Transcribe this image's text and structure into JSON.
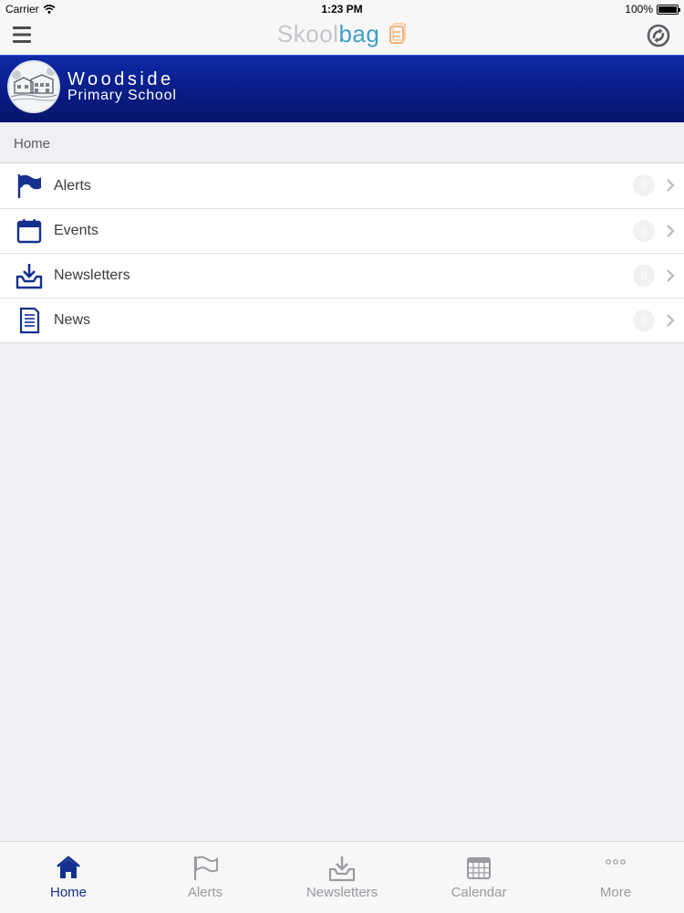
{
  "status_bar": {
    "carrier": "Carrier",
    "time": "1:23 PM",
    "battery": "100%",
    "battery_level_percent": 100
  },
  "nav_bar": {
    "brand_light": "Skool",
    "brand_accent": "bag",
    "menu_icon": "hamburger-menu-icon",
    "sync_icon": "sync-icon"
  },
  "school": {
    "name_line1": "Woodside",
    "name_line2": "Primary School"
  },
  "breadcrumb": "Home",
  "menu_items": [
    {
      "label": "Alerts",
      "icon": "flag-icon",
      "badge": "0"
    },
    {
      "label": "Events",
      "icon": "calendar-icon",
      "badge": "0"
    },
    {
      "label": "Newsletters",
      "icon": "inbox-download-icon",
      "badge": "0"
    },
    {
      "label": "News",
      "icon": "document-icon",
      "badge": "0"
    }
  ],
  "tabs": [
    {
      "label": "Home",
      "icon": "home-icon",
      "active": true
    },
    {
      "label": "Alerts",
      "icon": "flag-icon",
      "active": false
    },
    {
      "label": "Newsletters",
      "icon": "inbox-download-icon",
      "active": false
    },
    {
      "label": "Calendar",
      "icon": "calendar-grid-icon",
      "active": false
    },
    {
      "label": "More",
      "icon": "more-dots-icon",
      "active": false
    }
  ],
  "colors": {
    "banner_blue": "#0a1f8c",
    "icon_blue": "#13308f",
    "brand_accent": "#3f9fc6",
    "tab_inactive": "#9a9aa0",
    "background": "#efeff4"
  }
}
